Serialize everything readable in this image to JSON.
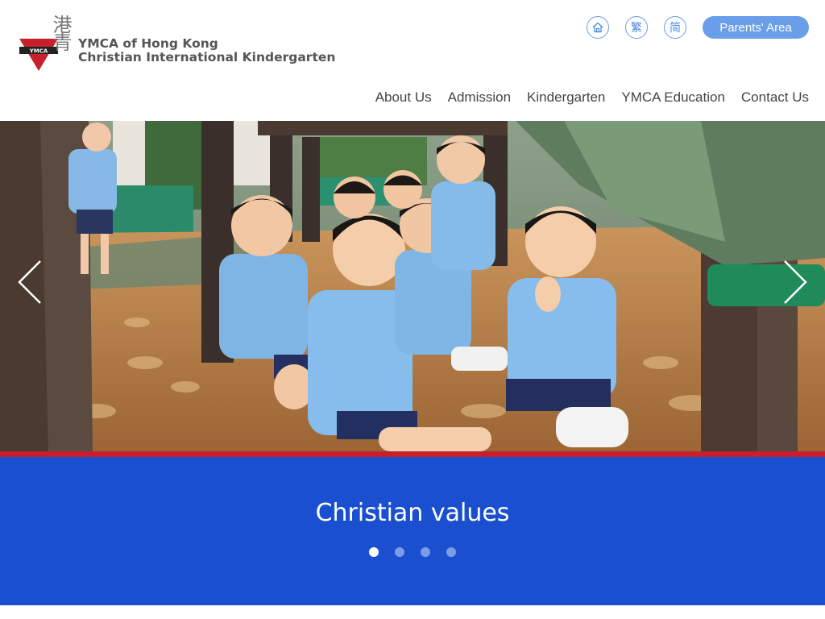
{
  "brand": {
    "name_line1": "YMCA of Hong Kong",
    "name_line2": "Christian International Kindergarten",
    "chinese_mark": "港青",
    "mark_text": "YMCA",
    "colors": {
      "red": "#c8202a",
      "dark": "#222222"
    }
  },
  "utility": {
    "home_icon": "home-icon",
    "traditional_label": "繁",
    "simplified_label": "简",
    "parents_area_label": "Parents' Area"
  },
  "nav": {
    "items": [
      {
        "label": "About Us"
      },
      {
        "label": "Admission"
      },
      {
        "label": "Kindergarten"
      },
      {
        "label": "YMCA Education"
      },
      {
        "label": "Contact Us"
      }
    ]
  },
  "hero": {
    "image_subject": "children in blue uniforms sitting under playground structure",
    "prev_icon": "chevron-left-icon",
    "next_icon": "chevron-right-icon"
  },
  "slider": {
    "caption": "Christian values",
    "slide_count": 4,
    "active_index": 0
  },
  "colors": {
    "accent_blue": "#1a50d0",
    "button_blue": "#6a9ee8",
    "stripe_red": "#c8202a"
  }
}
